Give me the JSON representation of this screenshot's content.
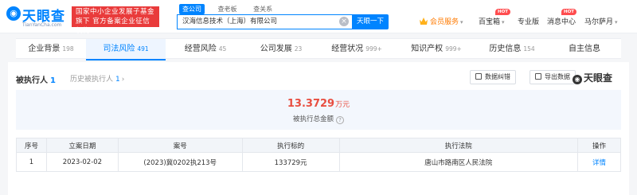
{
  "header": {
    "logo_text": "天眼查",
    "logo_sub": "TianYanCha.com",
    "gov_badge": "国家中小企业发展子基金旗下 官方备案企业征信机构",
    "search_tabs": [
      "查公司",
      "查老板",
      "查关系"
    ],
    "search_value": "汉海信息技术（上海）有限公司",
    "search_button": "天眼一下",
    "nav": {
      "vip": "会员服务",
      "box": "百宝箱",
      "pro": "专业版",
      "messages": "消息中心",
      "user": "马尔萨月",
      "hot": "HOT"
    }
  },
  "tabs": [
    {
      "label": "企业背景",
      "count": "198"
    },
    {
      "label": "司法风险",
      "count": "491"
    },
    {
      "label": "经营风险",
      "count": "45"
    },
    {
      "label": "公司发展",
      "count": "23"
    },
    {
      "label": "经营状况",
      "count": "999+"
    },
    {
      "label": "知识产权",
      "count": "999+"
    },
    {
      "label": "历史信息",
      "count": "154"
    },
    {
      "label": "自主信息",
      "count": ""
    }
  ],
  "section": {
    "title": "被执行人",
    "title_count": "1",
    "history_label": "历史被执行人",
    "history_count": "1",
    "history_arrow": "›",
    "fix_button": "数据纠错",
    "export_button": "导出数据",
    "watermark": "天眼查"
  },
  "summary": {
    "amount": "13.3729",
    "unit": "万元",
    "label": "被执行总金额",
    "help": "?"
  },
  "table": {
    "headers": [
      "序号",
      "立案日期",
      "案号",
      "执行标的",
      "执行法院",
      "操作"
    ],
    "rows": [
      [
        "1",
        "2023-02-02",
        "(2023)冀0202执213号",
        "133729元",
        "唐山市路南区人民法院",
        "详情"
      ]
    ]
  },
  "colors": {
    "brand": "#0084ff",
    "danger": "#e84e40",
    "badge": "#e93b3b",
    "vip": "#ff7a00"
  }
}
